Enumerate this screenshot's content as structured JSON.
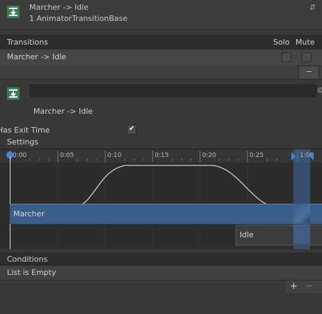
{
  "header": {
    "title": "Marcher -> Idle",
    "subtitle": "1 AnimatorTransitionBase"
  },
  "transitions": {
    "header_label": "Transitions",
    "solo_label": "Solo",
    "mute_label": "Mute",
    "rows": [
      {
        "label": "Marcher -> Idle"
      }
    ],
    "remove_label": "−"
  },
  "detail": {
    "name_value": "",
    "subtitle": "Marcher -> Idle"
  },
  "settings": {
    "has_exit_time_label": "Has Exit Time",
    "has_exit_time_checked": "✔",
    "settings_label": "Settings"
  },
  "timeline": {
    "ticks": [
      "0:00",
      "0:05",
      "0:10",
      "0:15",
      "0:20",
      "0:25",
      "1:00"
    ],
    "source_label": "Marcher",
    "target_label": "Idle"
  },
  "conditions": {
    "header_label": "Conditions",
    "empty_label": "List is Empty",
    "add_label": "+",
    "remove_label": "−"
  }
}
